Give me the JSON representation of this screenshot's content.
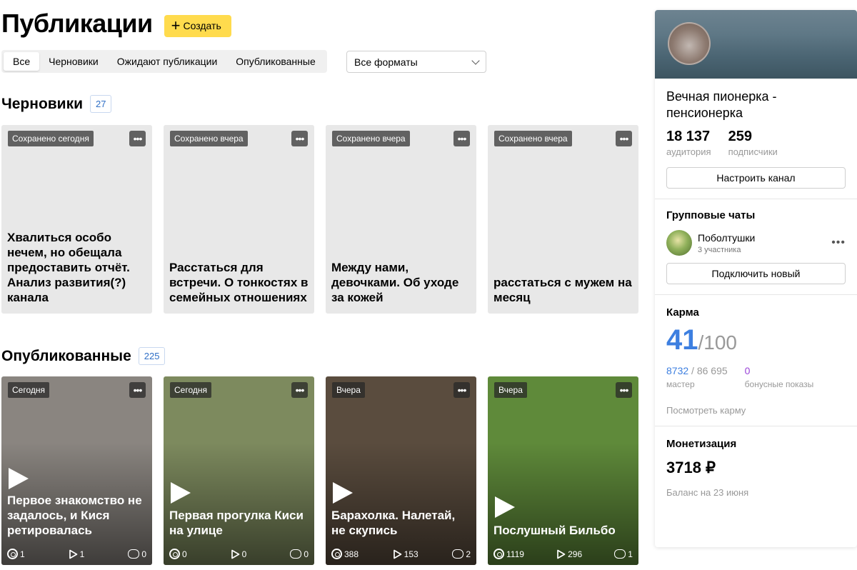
{
  "header": {
    "title": "Публикации",
    "create_label": "Создать"
  },
  "tabs": [
    "Все",
    "Черновики",
    "Ожидают публикации",
    "Опубликованные"
  ],
  "format_select": {
    "value": "Все форматы"
  },
  "drafts": {
    "title": "Черновики",
    "count": "27",
    "cards": [
      {
        "label": "Сохранено сегодня",
        "title": "Хвалиться особо нечем, но обещала предоставить отчёт. Анализ развития(?) канала"
      },
      {
        "label": "Сохранено вчера",
        "title": "Расстаться для встречи. О тонкостях в семейных отношениях"
      },
      {
        "label": "Сохранено вчера",
        "title": "Между нами, девочками. Об уходе за кожей"
      },
      {
        "label": "Сохранено вчера",
        "title": "расстаться с мужем на месяц"
      }
    ]
  },
  "published": {
    "title": "Опубликованные",
    "count": "225",
    "cards": [
      {
        "label": "Сегодня",
        "title": "Первое знакомство не задалось, и Кися ретировалась",
        "views": "1",
        "plays": "1",
        "comments": "0",
        "bg": "#8a8580"
      },
      {
        "label": "Сегодня",
        "title": "Первая прогулка Киси на улице",
        "views": "0",
        "plays": "0",
        "comments": "0",
        "bg": "#7d8a5e"
      },
      {
        "label": "Вчера",
        "title": "Барахолка. Налетай, не скупись",
        "views": "388",
        "plays": "153",
        "comments": "2",
        "bg": "#5a4c3e"
      },
      {
        "label": "Вчера",
        "title": "Послушный Бильбо",
        "views": "1119",
        "plays": "296",
        "comments": "1",
        "bg": "#5f8a3a"
      }
    ]
  },
  "sidebar": {
    "channel_name": "Вечная пионерка - пенсионерка",
    "audience": {
      "value": "18 137",
      "label": "аудитория"
    },
    "subscribers": {
      "value": "259",
      "label": "подписчики"
    },
    "configure_label": "Настроить канал",
    "chats": {
      "title": "Групповые чаты",
      "chat_name": "Поболтушки",
      "chat_members": "3 участника",
      "connect_label": "Подключить новый"
    },
    "karma": {
      "title": "Карма",
      "value": "41",
      "max": "/100",
      "master_value": "8732",
      "master_total": "/ 86 695",
      "master_label": "мастер",
      "bonus_value": "0",
      "bonus_label": "бонусные показы",
      "link": "Посмотреть карму"
    },
    "monetization": {
      "title": "Монетизация",
      "amount": "3718 ₽",
      "balance_label": "Баланс на 23 июня"
    }
  },
  "colors": {
    "accent": "#ffdb4d",
    "link_blue": "#3d7fe0",
    "purple": "#9a44d8"
  }
}
